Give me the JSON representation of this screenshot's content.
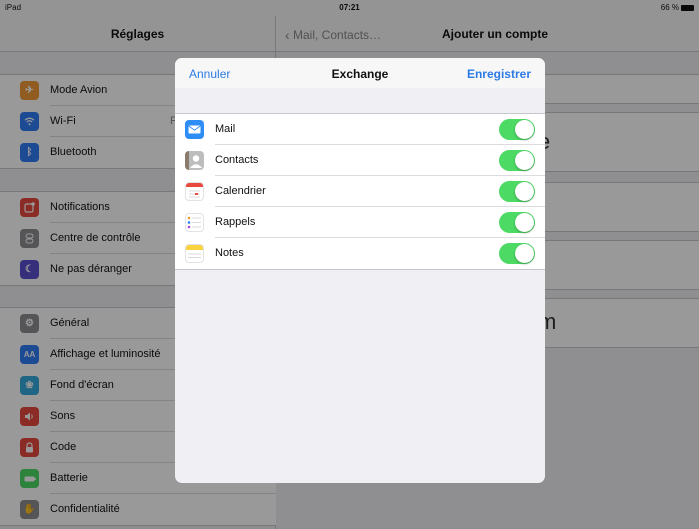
{
  "status_bar": {
    "device": "iPad",
    "time": "07:21",
    "battery": "66 %"
  },
  "left": {
    "title": "Réglages",
    "group1": [
      {
        "label": "Mode Avion",
        "icon": "airplane-icon",
        "color": "#f19a37"
      },
      {
        "label": "Wi-Fi",
        "icon": "wifi-icon",
        "color": "#2f7cf6",
        "value": "F"
      },
      {
        "label": "Bluetooth",
        "icon": "bluetooth-icon",
        "color": "#2f7cf6"
      }
    ],
    "group2": [
      {
        "label": "Notifications",
        "icon": "notifications-icon",
        "color": "#e8483e"
      },
      {
        "label": "Centre de contrôle",
        "icon": "control-center-icon",
        "color": "#8e8e93"
      },
      {
        "label": "Ne pas déranger",
        "icon": "moon-icon",
        "color": "#5a4fcf"
      }
    ],
    "group3": [
      {
        "label": "Général",
        "icon": "gear-icon",
        "color": "#8e8e93"
      },
      {
        "label": "Affichage et luminosité",
        "icon": "display-icon",
        "color": "#2f7cf6"
      },
      {
        "label": "Fond d'écran",
        "icon": "wallpaper-icon",
        "color": "#35aadc"
      },
      {
        "label": "Sons",
        "icon": "sound-icon",
        "color": "#e8483e"
      },
      {
        "label": "Code",
        "icon": "lock-icon",
        "color": "#e8483e"
      },
      {
        "label": "Batterie",
        "icon": "battery-icon",
        "color": "#4cd964"
      },
      {
        "label": "Confidentialité",
        "icon": "hand-icon",
        "color": "#8e8e93"
      }
    ]
  },
  "right": {
    "back_label": "Mail, Contacts…",
    "title": "Ajouter un compte",
    "partial_text_1": "e",
    "partial_text_2": "m"
  },
  "modal": {
    "cancel_label": "Annuler",
    "title": "Exchange",
    "save_label": "Enregistrer",
    "items": [
      {
        "label": "Mail",
        "icon": "mail-icon",
        "color": "#2f8ef6",
        "enabled": true
      },
      {
        "label": "Contacts",
        "icon": "contacts-icon",
        "color": "#a9a9a9",
        "enabled": true
      },
      {
        "label": "Calendrier",
        "icon": "calendar-icon",
        "color": "#ffffff",
        "enabled": true
      },
      {
        "label": "Rappels",
        "icon": "reminders-icon",
        "color": "#ffffff",
        "enabled": true
      },
      {
        "label": "Notes",
        "icon": "notes-icon",
        "color": "#fbd33e",
        "enabled": true
      }
    ]
  }
}
